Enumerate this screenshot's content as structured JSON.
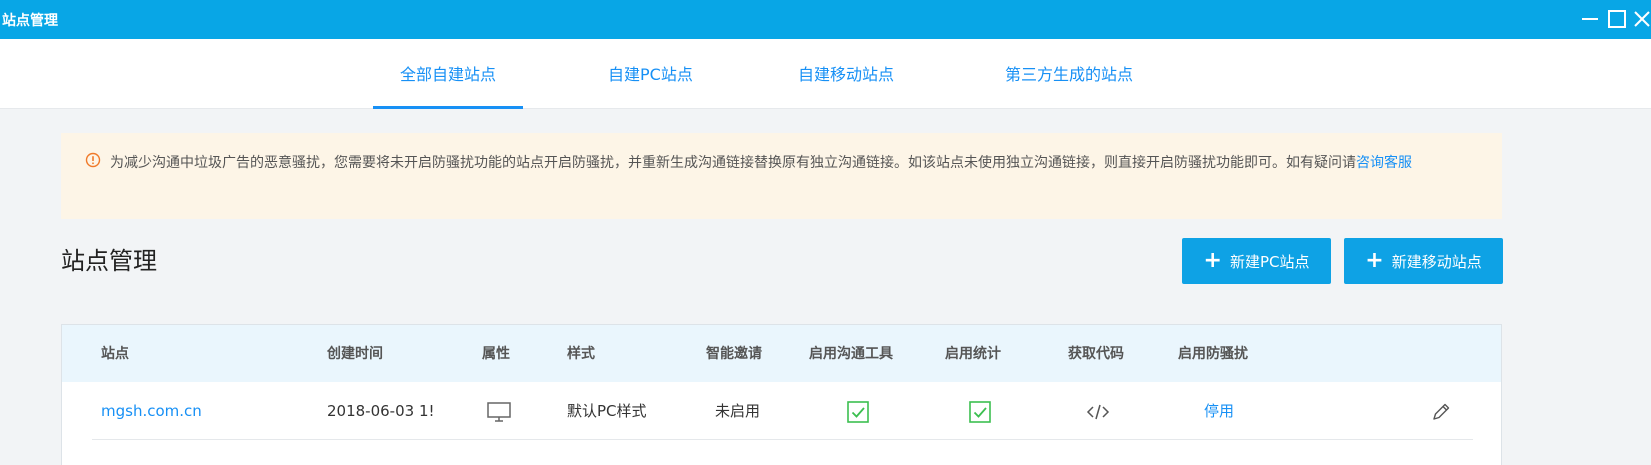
{
  "window": {
    "title": "站点管理"
  },
  "tabs": [
    {
      "label": "全部自建站点",
      "active": true
    },
    {
      "label": "自建PC站点",
      "active": false
    },
    {
      "label": "自建移动站点",
      "active": false
    },
    {
      "label": "第三方生成的站点",
      "active": false
    }
  ],
  "notice": {
    "text_before_link": "为减少沟通中垃圾广告的恶意骚扰，您需要将未开启防骚扰功能的站点开启防骚扰，并重新生成沟通链接替换原有独立沟通链接。如该站点未使用独立沟通链接，则直接开启防骚扰功能即可。如有疑问请",
    "link": "咨询客服"
  },
  "page": {
    "title": "站点管理",
    "new_pc_button": "新建PC站点",
    "new_mobile_button": "新建移动站点",
    "plus_glyph": "+"
  },
  "table": {
    "columns": [
      "站点",
      "创建时间",
      "属性",
      "样式",
      "智能邀请",
      "启用沟通工具",
      "启用统计",
      "获取代码",
      "启用防骚扰"
    ],
    "rows": [
      {
        "site": "mgsh.com.cn",
        "created": "2018-06-03 1!",
        "attribute_icon": "monitor-icon",
        "style": "默认PC样式",
        "smart_invite": "未启用",
        "chat_tool_icon": "check-square-icon",
        "stats_icon": "check-square-icon",
        "code_icon": "code-icon",
        "anti_harass": "停用",
        "action_icon": "pencil-icon"
      }
    ]
  },
  "colors": {
    "titlebar": "#08a6e6",
    "accent": "#1790f5",
    "check": "#3cbf50",
    "notice_bg": "#fdf5e7",
    "table_header_bg": "#eaf6fd"
  }
}
